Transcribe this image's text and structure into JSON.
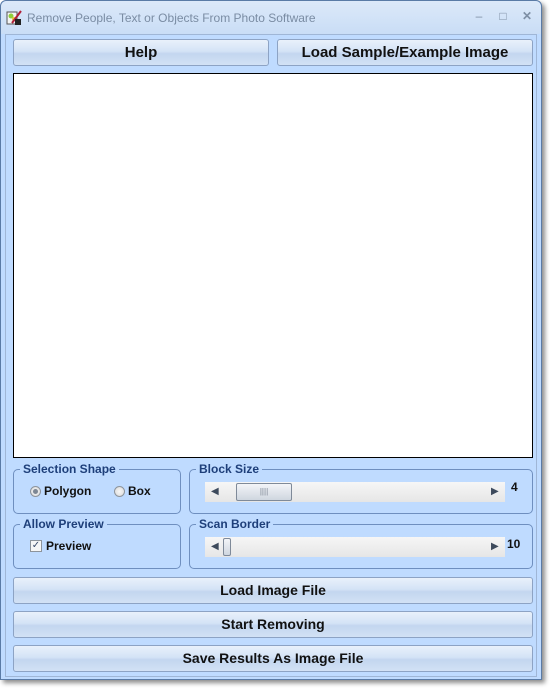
{
  "window": {
    "title": "Remove People, Text or Objects From Photo Software",
    "controls": {
      "minimize": "–",
      "maximize": "□",
      "close": "✕"
    },
    "icon": "app-paint-icon"
  },
  "toolbar": {
    "help_label": "Help",
    "load_sample_label": "Load Sample/Example Image"
  },
  "selection_shape": {
    "label": "Selection Shape",
    "options": [
      {
        "label": "Polygon",
        "selected": true
      },
      {
        "label": "Box",
        "selected": false
      }
    ]
  },
  "block_size": {
    "label": "Block Size",
    "value": "4",
    "thumb_grip": "||||"
  },
  "allow_preview": {
    "label": "Allow Preview",
    "checkbox_label": "Preview",
    "checked": true,
    "check_glyph": "✓"
  },
  "scan_border": {
    "label": "Scan Border",
    "value": "10"
  },
  "actions": {
    "load_image_label": "Load Image File",
    "start_removing_label": "Start Removing",
    "save_results_label": "Save Results As Image File"
  },
  "arrows": {
    "left": "◀",
    "right": "▶"
  }
}
